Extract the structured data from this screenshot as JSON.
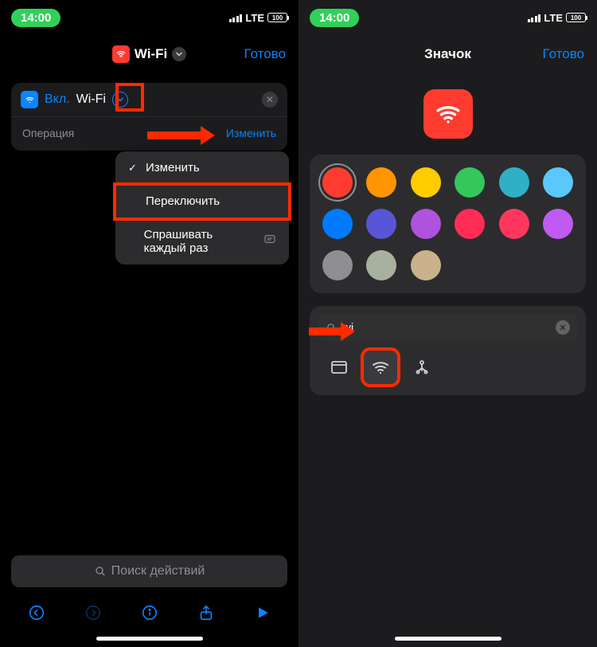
{
  "status": {
    "time": "14:00",
    "network": "LTE",
    "battery": "100"
  },
  "left": {
    "nav": {
      "title": "Wi-Fi",
      "done": "Готово"
    },
    "action": {
      "on": "Вкл.",
      "wifi": "Wi-Fi",
      "operation": "Операция",
      "change": "Изменить"
    },
    "popup": {
      "item1": "Изменить",
      "item2": "Переключить",
      "item3": "Спрашивать каждый раз"
    },
    "search_placeholder": "Поиск действий"
  },
  "right": {
    "nav": {
      "title": "Значок",
      "done": "Готово"
    },
    "colors": [
      "#ff3b30",
      "#ff9500",
      "#ffcc00",
      "#34c759",
      "#30b0c7",
      "#5ac8fa",
      "#007aff",
      "#5856d6",
      "#af52de",
      "#ff2d55",
      "#ff375f",
      "#bf5af2",
      "#8e8e93",
      "#a8b0a0",
      "#c9b28b"
    ],
    "search_value": "wi"
  }
}
